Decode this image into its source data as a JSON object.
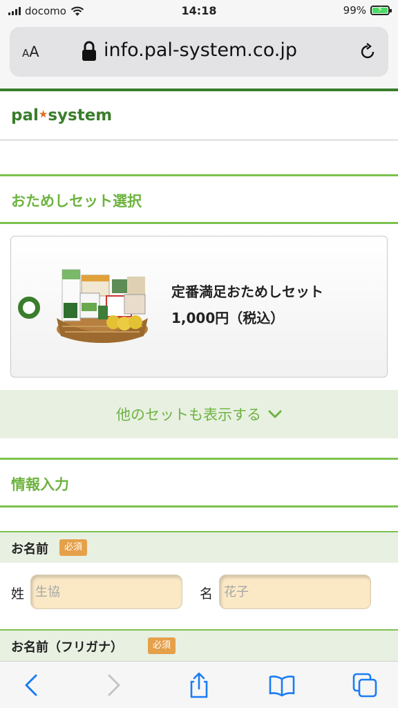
{
  "status_bar": {
    "carrier": "docomo",
    "time": "14:18",
    "battery": "99%",
    "battery_level": 0.99
  },
  "browser": {
    "reader_label_big": "A",
    "reader_label_small": "A",
    "url": "info.pal-system.co.jp"
  },
  "site": {
    "logo_left": "pal",
    "logo_right": "system"
  },
  "trial_section": {
    "title": "おためしセット選択"
  },
  "trial_set": {
    "name": "定番満足おためしセット",
    "price": "1,000円（税込）",
    "selected": true
  },
  "show_more": {
    "label": "他のセットも表示する"
  },
  "info_section": {
    "title": "情報入力"
  },
  "name_field": {
    "label": "お名前",
    "required": "必須",
    "last_label": "姓",
    "last_placeholder": "生協",
    "first_label": "名",
    "first_placeholder": "花子"
  },
  "kana_field": {
    "label": "お名前（フリガナ）",
    "required": "必須"
  },
  "colors": {
    "brand_green": "#3a7d2c",
    "accent_green": "#6db33f",
    "required_badge": "#e5a04a",
    "input_bg": "#fbe9c6"
  },
  "toolbar": {
    "icons": [
      "back-icon",
      "forward-icon",
      "share-icon",
      "bookmarks-icon",
      "tabs-icon"
    ]
  }
}
